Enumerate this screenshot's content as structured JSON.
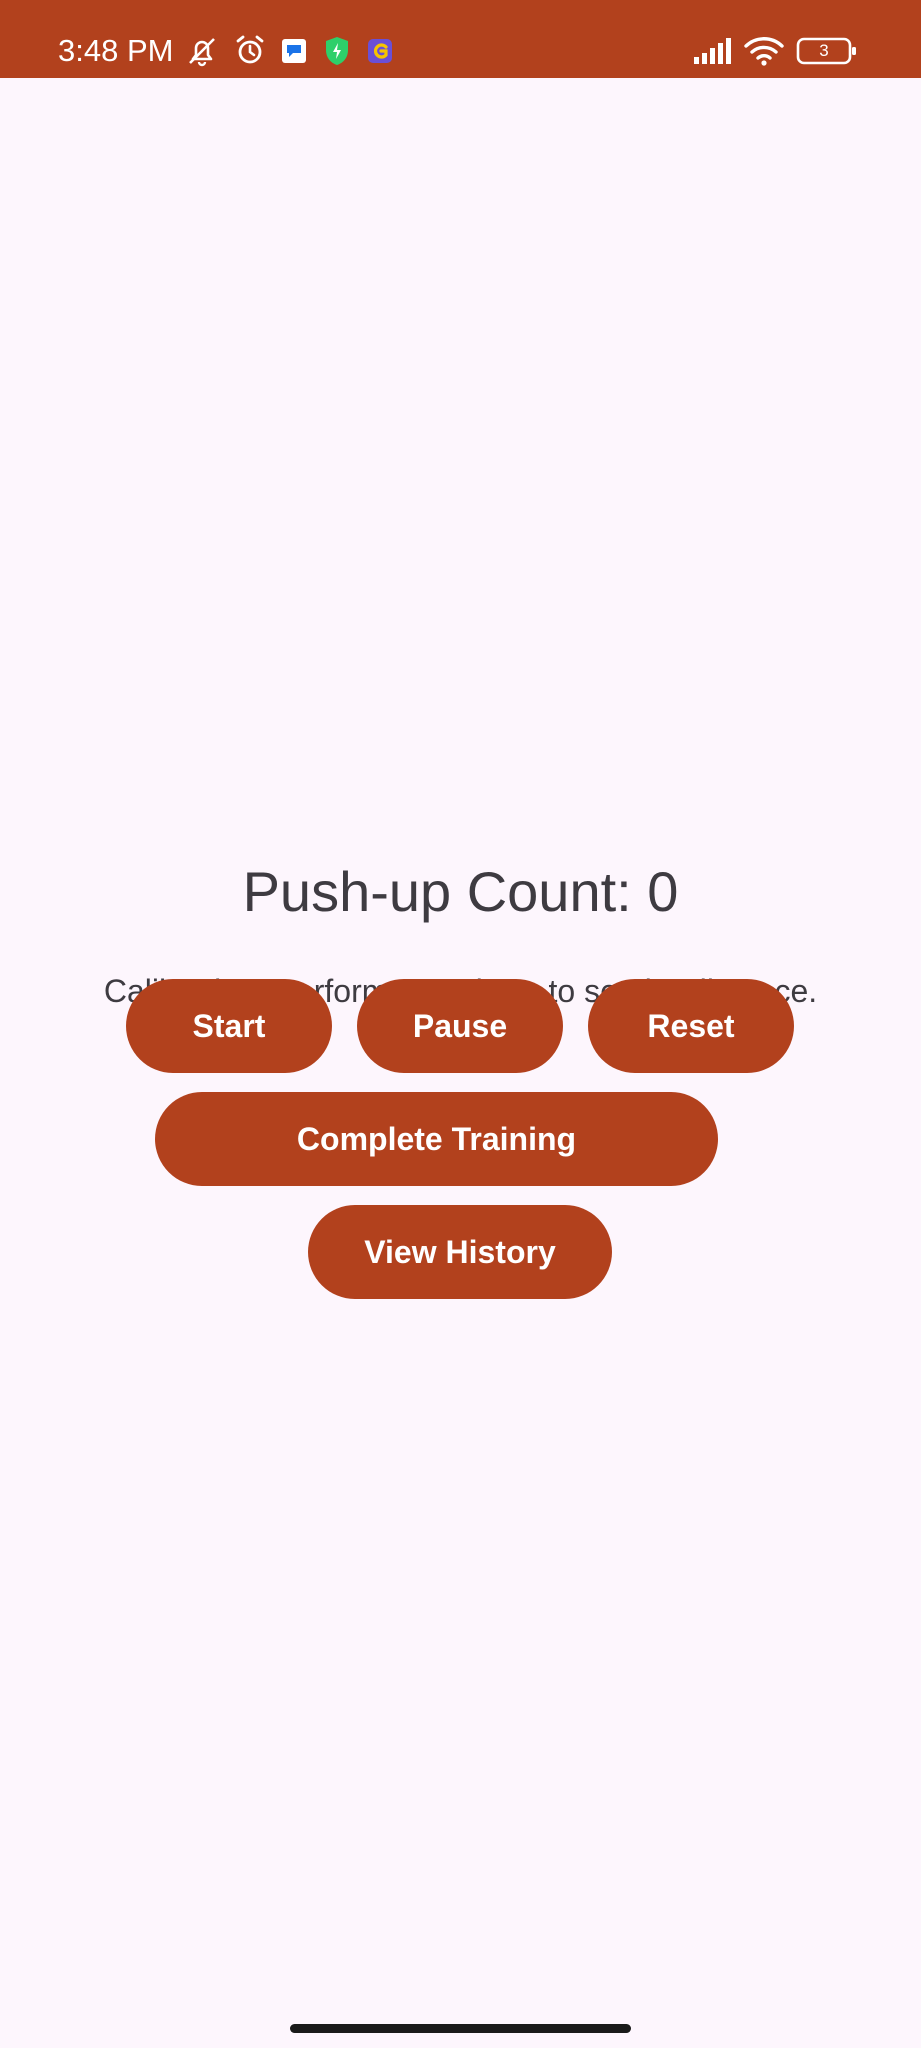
{
  "status_bar": {
    "time": "3:48 PM",
    "battery_level": "3",
    "icons": [
      "notification-off-icon",
      "alarm-icon",
      "message-app-icon",
      "security-shield-icon",
      "app-g-icon",
      "signal-icon",
      "wifi-icon",
      "battery-icon"
    ],
    "background_color": "#b2411d"
  },
  "main": {
    "count_label": "Push-up Count: 0",
    "calibration_text": "Calibration: Perform a push-up to set the distance.",
    "buttons": {
      "start": "Start",
      "pause": "Pause",
      "reset": "Reset",
      "complete_training": "Complete Training",
      "view_history": "View History"
    },
    "button_color": "#b2411d",
    "background_color": "#fdf6fd"
  }
}
